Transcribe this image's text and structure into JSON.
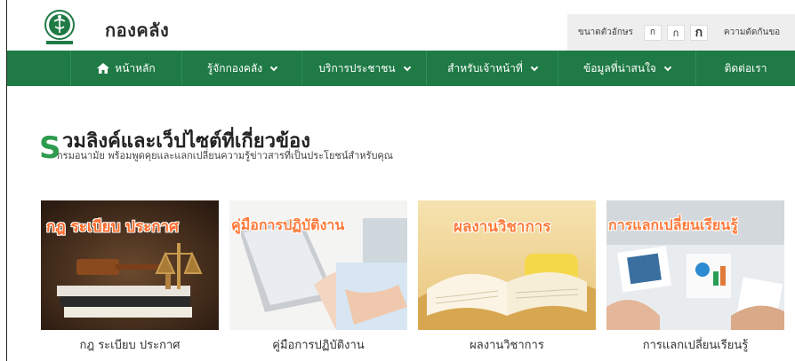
{
  "header": {
    "site_title": "กองคลัง",
    "font_size_label": "ขนาดตัวอักษร",
    "font_small": "ก",
    "font_medium": "ก",
    "font_large": "ก",
    "contrast_label": "ความตัดกันขอ"
  },
  "nav": {
    "items": [
      {
        "label": "หน้าหลัก",
        "icon": "home-icon"
      },
      {
        "label": "รู้จักกองคลัง",
        "icon": "chevron-down-icon"
      },
      {
        "label": "บริการประชาชน",
        "icon": "chevron-down-icon"
      },
      {
        "label": "สำหรับเจ้าหน้าที่",
        "icon": "chevron-down-icon"
      },
      {
        "label": "ข้อมูลที่น่าสนใจ",
        "icon": "chevron-down-icon"
      },
      {
        "label": "ติดต่อเรา"
      }
    ]
  },
  "section": {
    "big_letter": "S",
    "title": "วมลิงค์และเว็ปไซต์ที่เกี่ยวข้อง",
    "subtitle": "กรมอนามัย พร้อมพูดคุยและแลกเปลี่ยนความรู้ข่าวสารที่เป็นประโยชน์สำหรับคุณ"
  },
  "cards": [
    {
      "overlay": "กฎ ระเบียบ ประกาศ",
      "label": "กฎ ระเบียบ ประกาศ"
    },
    {
      "overlay": "คู่มือการปฏิบัติงาน",
      "label": "คู่มือการปฏิบัติงาน"
    },
    {
      "overlay": "ผลงานวิชาการ",
      "label": "ผลงานวิชาการ"
    },
    {
      "overlay": "การแลกเปลี่ยนเรียนรู้",
      "label": "การแลกเปลี่ยนเรียนรู้"
    }
  ],
  "colors": {
    "nav_bg": "#1f7a45",
    "accent_green": "#2e9b4f",
    "overlay_orange": "#ff7a3a"
  }
}
